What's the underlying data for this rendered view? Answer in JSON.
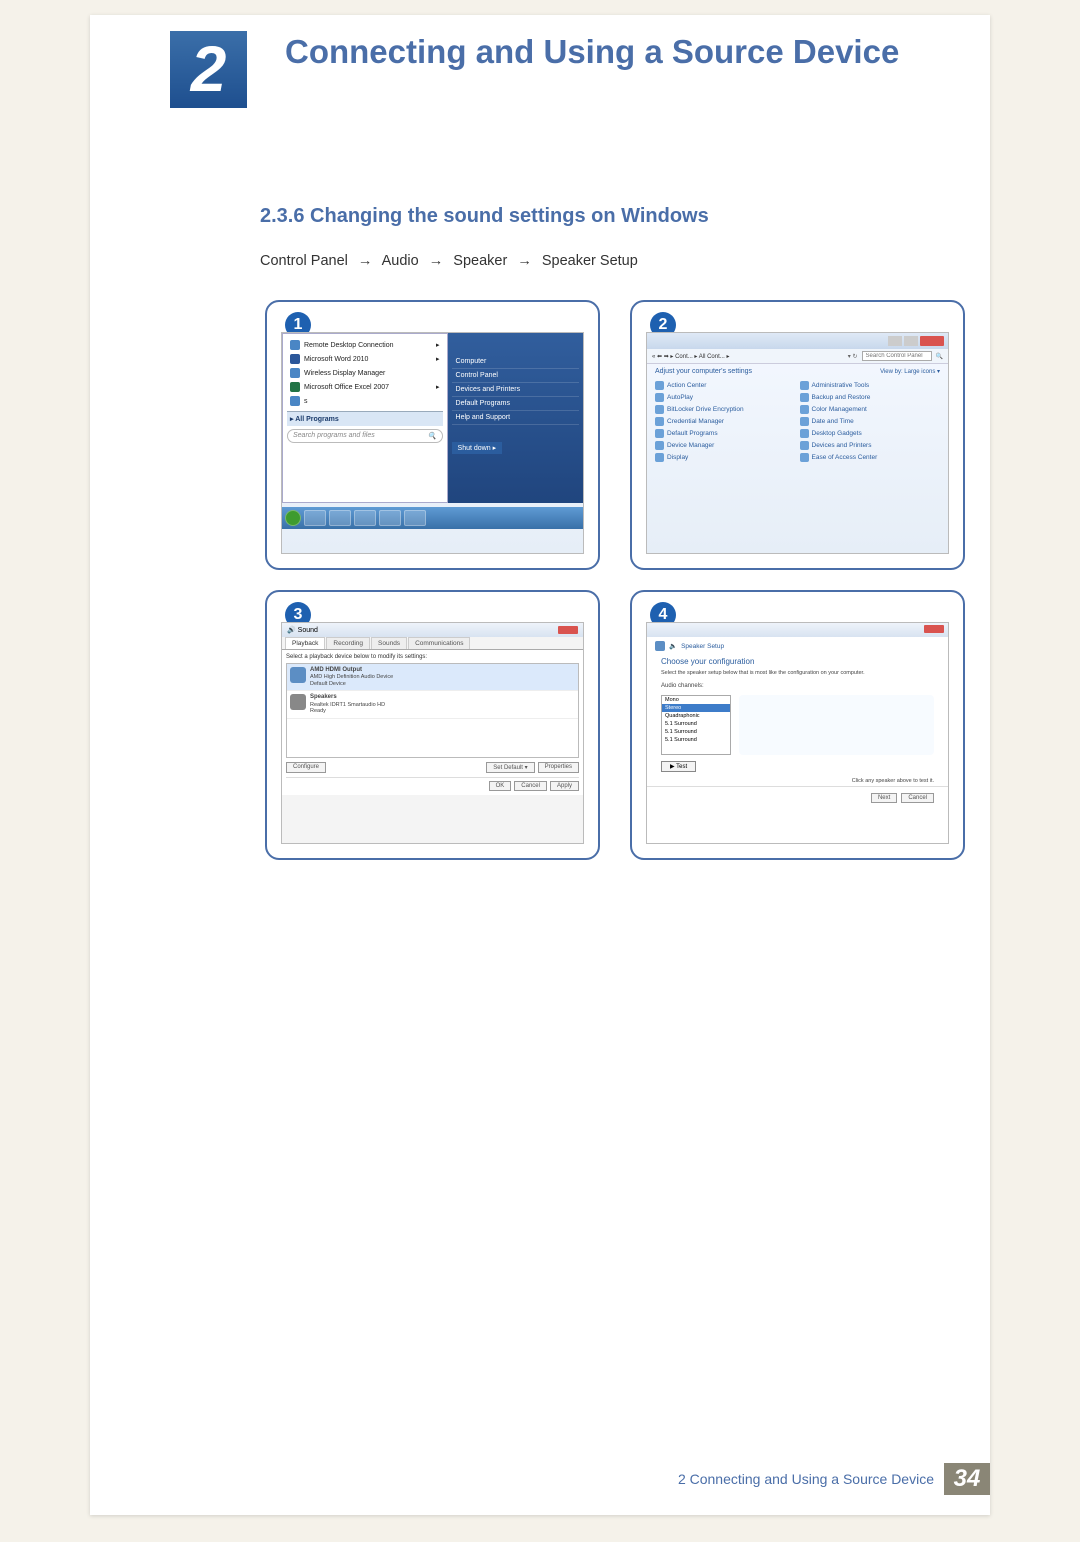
{
  "chapter": {
    "number": "2",
    "title": "Connecting and Using a Source Device"
  },
  "section": {
    "number": "2.3.6",
    "title": "Changing the sound settings on Windows"
  },
  "breadcrumb": {
    "a": "Control Panel",
    "b": "Audio",
    "c": "Speaker",
    "d": "Speaker Setup",
    "arrow": "→"
  },
  "badges": {
    "b1": "1",
    "b2": "2",
    "b3": "3",
    "b4": "4"
  },
  "panel1": {
    "left_items": [
      "Remote Desktop Connection",
      "Microsoft Word 2010",
      "Wireless Display Manager",
      "Microsoft Office Excel 2007",
      "s"
    ],
    "all_programs": "All Programs",
    "search_placeholder": "Search programs and files",
    "search_glyph": "🔍",
    "right_items": [
      "Computer",
      "Control Panel",
      "Devices and Printers",
      "Default Programs",
      "Help and Support"
    ],
    "shutdown": "Shut down ▸"
  },
  "panel2": {
    "path": "« ⬅ ➡ ▸ Cont... ▸ All Cont... ▸",
    "search_placeholder": "Search Control Panel",
    "adjust": "Adjust your computer's settings",
    "viewby": "View by:   Large icons ▾",
    "items": [
      "Action Center",
      "Administrative Tools",
      "AutoPlay",
      "Backup and Restore",
      "BitLocker Drive Encryption",
      "Color Management",
      "Credential Manager",
      "Date and Time",
      "Default Programs",
      "Desktop Gadgets",
      "Device Manager",
      "Devices and Printers",
      "Display",
      "Ease of Access Center"
    ]
  },
  "panel3": {
    "title": "Sound",
    "tabs": [
      "Playback",
      "Recording",
      "Sounds",
      "Communications"
    ],
    "instruction": "Select a playback device below to modify its settings:",
    "dev1": {
      "name": "AMD HDMI Output",
      "desc": "AMD High Definition Audio Device",
      "state": "Default Device"
    },
    "dev2": {
      "name": "Speakers",
      "desc": "Realtek IDRT1 Smartaudio HD",
      "state": "Ready"
    },
    "configure": "Configure",
    "set_default": "Set Default ▾",
    "properties": "Properties",
    "ok": "OK",
    "cancel": "Cancel",
    "apply": "Apply"
  },
  "panel4": {
    "bc": "Speaker Setup",
    "heading": "Choose your configuration",
    "sub": "Select the speaker setup below that is most like the configuration on your computer.",
    "label": "Audio channels:",
    "options": [
      "Mono",
      "Stereo",
      "Quadraphonic",
      "5.1 Surround",
      "5.1 Surround",
      "5.1 Surround"
    ],
    "test": "▶ Test",
    "note": "Click any speaker above to test it.",
    "next": "Next",
    "cancel": "Cancel"
  },
  "footer": {
    "text": "2 Connecting and Using a Source Device",
    "page": "34"
  }
}
